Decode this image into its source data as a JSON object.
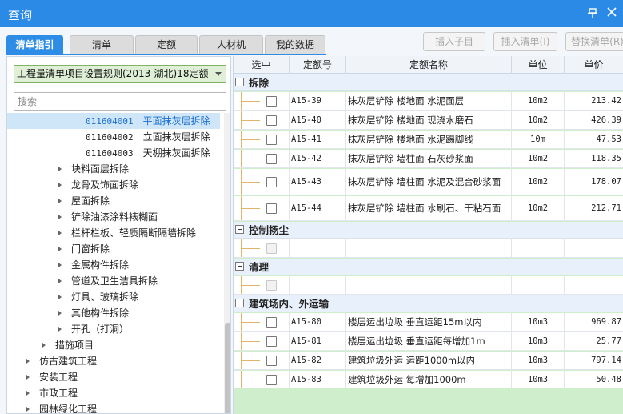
{
  "window": {
    "title": "查询",
    "pin_icon": "pin-icon",
    "close_icon": "close-icon"
  },
  "tabs": [
    {
      "label": "清单指引",
      "active": true
    },
    {
      "label": "清单",
      "active": false
    },
    {
      "label": "定额",
      "active": false
    },
    {
      "label": "人材机",
      "active": false
    },
    {
      "label": "我的数据",
      "active": false
    }
  ],
  "toolbar": {
    "insert_child": "插入子目",
    "insert_list": "插入清单(I)",
    "replace_list": "替换清单(R)"
  },
  "left": {
    "rule_select": "工程量清单项目设置规则(2013-湖北)18定额",
    "search_placeholder": "搜索",
    "tree": [
      {
        "code": "011604001",
        "name": "平面抹灰层拆除",
        "selected": true
      },
      {
        "code": "011604002",
        "name": "立面抹灰层拆除"
      },
      {
        "code": "011604003",
        "name": "天棚抹灰面拆除"
      },
      {
        "name": "块料面层拆除",
        "expandable": true
      },
      {
        "name": "龙骨及饰面拆除",
        "expandable": true
      },
      {
        "name": "屋面拆除",
        "expandable": true
      },
      {
        "name": "铲除油漆涂料裱糊面",
        "expandable": true
      },
      {
        "name": "栏杆栏板、轻质隔断隔墙拆除",
        "expandable": true
      },
      {
        "name": "门窗拆除",
        "expandable": true
      },
      {
        "name": "金属构件拆除",
        "expandable": true
      },
      {
        "name": "管道及卫生洁具拆除",
        "expandable": true
      },
      {
        "name": "灯具、玻璃拆除",
        "expandable": true
      },
      {
        "name": "其他构件拆除",
        "expandable": true
      },
      {
        "name": "开孔（打洞）",
        "expandable": true
      },
      {
        "name": "措施项目",
        "expandable": true
      },
      {
        "name": "仿古建筑工程",
        "expandable": true
      },
      {
        "name": "安装工程",
        "expandable": true
      },
      {
        "name": "市政工程",
        "expandable": true
      },
      {
        "name": "园林绿化工程",
        "expandable": true
      }
    ]
  },
  "grid": {
    "headers": {
      "select": "选中",
      "code": "定额号",
      "name": "定额名称",
      "unit": "单位",
      "price": "单价"
    },
    "groups": [
      {
        "name": "拆除",
        "rows": [
          {
            "code": "A15-39",
            "name": "抹灰层铲除 楼地面 水泥面层",
            "unit": "10m2",
            "price": "213.42"
          },
          {
            "code": "A15-40",
            "name": "抹灰层铲除 楼地面 现浇水磨石",
            "unit": "10m2",
            "price": "426.39"
          },
          {
            "code": "A15-41",
            "name": "抹灰层铲除 楼地面 水泥踢脚线",
            "unit": "10m",
            "price": "47.53"
          },
          {
            "code": "A15-42",
            "name": "抹灰层铲除 墙柱面 石灰砂浆面",
            "unit": "10m2",
            "price": "118.35"
          },
          {
            "code": "A15-43",
            "name": "抹灰层铲除 墙柱面 水泥及混合砂浆面",
            "unit": "10m2",
            "price": "178.07"
          },
          {
            "code": "A15-44",
            "name": "抹灰层铲除 墙柱面 水刷石、干粘石面",
            "unit": "10m2",
            "price": "212.71"
          }
        ]
      },
      {
        "name": "控制扬尘",
        "rows": []
      },
      {
        "name": "清理",
        "rows": []
      },
      {
        "name": "建筑场内、外运输",
        "rows": [
          {
            "code": "A15-80",
            "name": "楼层运出垃圾 垂直运距15m以内",
            "unit": "10m3",
            "price": "969.87"
          },
          {
            "code": "A15-81",
            "name": "楼层运出垃圾 垂直运距每增加1m",
            "unit": "10m3",
            "price": "25.77"
          },
          {
            "code": "A15-82",
            "name": "建筑垃圾外运 运距1000m以内",
            "unit": "10m3",
            "price": "797.14"
          },
          {
            "code": "A15-83",
            "name": "建筑垃圾外运 每增加1000m",
            "unit": "10m3",
            "price": "50.48"
          }
        ]
      }
    ]
  }
}
